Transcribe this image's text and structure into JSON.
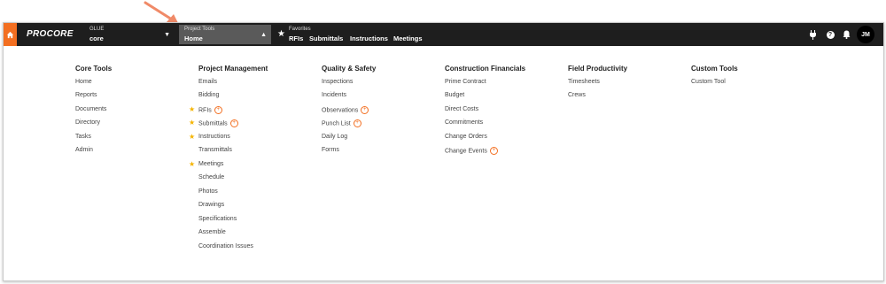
{
  "topbar": {
    "logo": "PROCORE",
    "project_selector": {
      "company": "GLUE",
      "project": "core"
    },
    "tool_selector": {
      "label": "Project Tools",
      "value": "Home"
    },
    "favorites": {
      "label": "Favorites",
      "links": [
        "RFIs",
        "Submittals",
        "Instructions",
        "Meetings"
      ]
    },
    "user_initials": "JM"
  },
  "menu": {
    "columns": [
      {
        "heading": "Core Tools",
        "items": [
          {
            "label": "Home",
            "star": false,
            "plus": false
          },
          {
            "label": "Reports",
            "star": false,
            "plus": false
          },
          {
            "label": "Documents",
            "star": false,
            "plus": false
          },
          {
            "label": "Directory",
            "star": false,
            "plus": false
          },
          {
            "label": "Tasks",
            "star": false,
            "plus": false
          },
          {
            "label": "Admin",
            "star": false,
            "plus": false
          }
        ]
      },
      {
        "heading": "Project Management",
        "items": [
          {
            "label": "Emails",
            "star": false,
            "plus": false
          },
          {
            "label": "Bidding",
            "star": false,
            "plus": false
          },
          {
            "label": "RFIs",
            "star": true,
            "plus": true
          },
          {
            "label": "Submittals",
            "star": true,
            "plus": true
          },
          {
            "label": "Instructions",
            "star": true,
            "plus": false
          },
          {
            "label": "Transmittals",
            "star": false,
            "plus": false
          },
          {
            "label": "Meetings",
            "star": true,
            "plus": false
          },
          {
            "label": "Schedule",
            "star": false,
            "plus": false
          },
          {
            "label": "Photos",
            "star": false,
            "plus": false
          },
          {
            "label": "Drawings",
            "star": false,
            "plus": false
          },
          {
            "label": "Specifications",
            "star": false,
            "plus": false
          },
          {
            "label": "Assemble",
            "star": false,
            "plus": false
          },
          {
            "label": "Coordination Issues",
            "star": false,
            "plus": false
          }
        ]
      },
      {
        "heading": "Quality & Safety",
        "items": [
          {
            "label": "Inspections",
            "star": false,
            "plus": false
          },
          {
            "label": "Incidents",
            "star": false,
            "plus": false
          },
          {
            "label": "Observations",
            "star": false,
            "plus": true
          },
          {
            "label": "Punch List",
            "star": false,
            "plus": true
          },
          {
            "label": "Daily Log",
            "star": false,
            "plus": false
          },
          {
            "label": "Forms",
            "star": false,
            "plus": false
          }
        ]
      },
      {
        "heading": "Construction Financials",
        "items": [
          {
            "label": "Prime Contract",
            "star": false,
            "plus": false
          },
          {
            "label": "Budget",
            "star": false,
            "plus": false
          },
          {
            "label": "Direct Costs",
            "star": false,
            "plus": false
          },
          {
            "label": "Commitments",
            "star": false,
            "plus": false
          },
          {
            "label": "Change Orders",
            "star": false,
            "plus": false
          },
          {
            "label": "Change Events",
            "star": false,
            "plus": true
          }
        ]
      },
      {
        "heading": "Field Productivity",
        "items": [
          {
            "label": "Timesheets",
            "star": false,
            "plus": false
          },
          {
            "label": "Crews",
            "star": false,
            "plus": false
          }
        ]
      },
      {
        "heading": "Custom Tools",
        "items": [
          {
            "label": "Custom Tool",
            "star": false,
            "plus": false
          }
        ]
      }
    ]
  },
  "colors": {
    "topbar_bg": "#1e1e1e",
    "accent": "#f36f21",
    "star": "#f5b400",
    "selected_tool_bg": "#5a5a5a"
  }
}
